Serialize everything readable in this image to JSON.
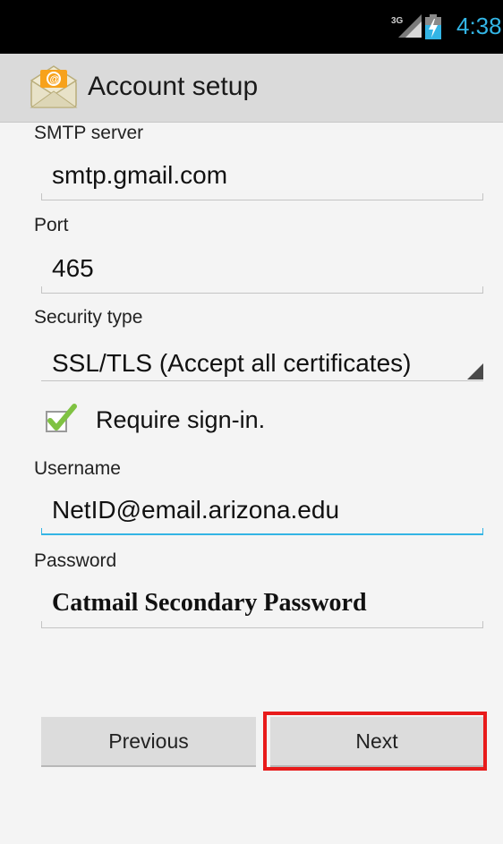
{
  "status_bar": {
    "network": "3G",
    "time": "4:38",
    "colors": {
      "accent": "#33b5e5"
    }
  },
  "action_bar": {
    "title": "Account setup",
    "icon": "email-envelope-icon"
  },
  "form": {
    "smtp_server": {
      "label": "SMTP server",
      "value": "smtp.gmail.com"
    },
    "port": {
      "label": "Port",
      "value": "465"
    },
    "security_type": {
      "label": "Security type",
      "value": "SSL/TLS (Accept all certificates)"
    },
    "require_signin": {
      "label": "Require sign-in.",
      "checked": true
    },
    "username": {
      "label": "Username",
      "value": "NetID@email.arizona.edu"
    },
    "password": {
      "label": "Password",
      "value": "Catmail Secondary Password"
    }
  },
  "buttons": {
    "previous": "Previous",
    "next": "Next"
  },
  "highlight_color": "#e81b1b"
}
